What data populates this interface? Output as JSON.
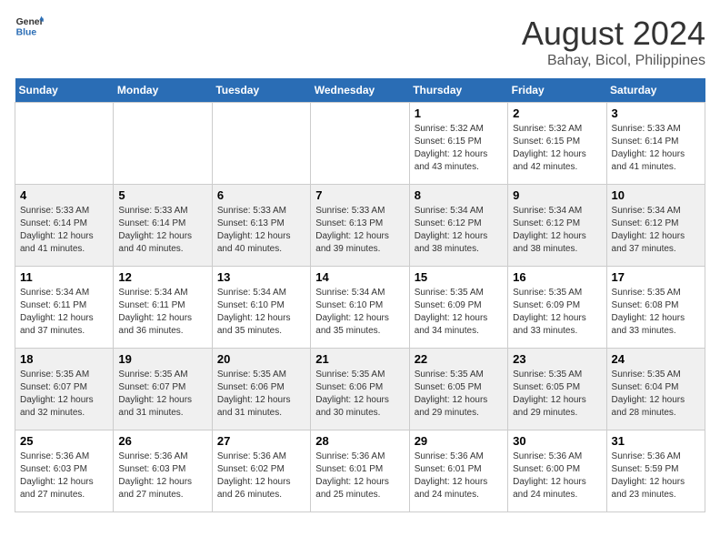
{
  "header": {
    "logo_line1": "General",
    "logo_line2": "Blue",
    "main_title": "August 2024",
    "subtitle": "Bahay, Bicol, Philippines"
  },
  "days_of_week": [
    "Sunday",
    "Monday",
    "Tuesday",
    "Wednesday",
    "Thursday",
    "Friday",
    "Saturday"
  ],
  "weeks": [
    {
      "days": [
        {
          "number": "",
          "info": ""
        },
        {
          "number": "",
          "info": ""
        },
        {
          "number": "",
          "info": ""
        },
        {
          "number": "",
          "info": ""
        },
        {
          "number": "1",
          "info": "Sunrise: 5:32 AM\nSunset: 6:15 PM\nDaylight: 12 hours and 43 minutes."
        },
        {
          "number": "2",
          "info": "Sunrise: 5:32 AM\nSunset: 6:15 PM\nDaylight: 12 hours and 42 minutes."
        },
        {
          "number": "3",
          "info": "Sunrise: 5:33 AM\nSunset: 6:14 PM\nDaylight: 12 hours and 41 minutes."
        }
      ]
    },
    {
      "days": [
        {
          "number": "4",
          "info": "Sunrise: 5:33 AM\nSunset: 6:14 PM\nDaylight: 12 hours and 41 minutes."
        },
        {
          "number": "5",
          "info": "Sunrise: 5:33 AM\nSunset: 6:14 PM\nDaylight: 12 hours and 40 minutes."
        },
        {
          "number": "6",
          "info": "Sunrise: 5:33 AM\nSunset: 6:13 PM\nDaylight: 12 hours and 40 minutes."
        },
        {
          "number": "7",
          "info": "Sunrise: 5:33 AM\nSunset: 6:13 PM\nDaylight: 12 hours and 39 minutes."
        },
        {
          "number": "8",
          "info": "Sunrise: 5:34 AM\nSunset: 6:12 PM\nDaylight: 12 hours and 38 minutes."
        },
        {
          "number": "9",
          "info": "Sunrise: 5:34 AM\nSunset: 6:12 PM\nDaylight: 12 hours and 38 minutes."
        },
        {
          "number": "10",
          "info": "Sunrise: 5:34 AM\nSunset: 6:12 PM\nDaylight: 12 hours and 37 minutes."
        }
      ]
    },
    {
      "days": [
        {
          "number": "11",
          "info": "Sunrise: 5:34 AM\nSunset: 6:11 PM\nDaylight: 12 hours and 37 minutes."
        },
        {
          "number": "12",
          "info": "Sunrise: 5:34 AM\nSunset: 6:11 PM\nDaylight: 12 hours and 36 minutes."
        },
        {
          "number": "13",
          "info": "Sunrise: 5:34 AM\nSunset: 6:10 PM\nDaylight: 12 hours and 35 minutes."
        },
        {
          "number": "14",
          "info": "Sunrise: 5:34 AM\nSunset: 6:10 PM\nDaylight: 12 hours and 35 minutes."
        },
        {
          "number": "15",
          "info": "Sunrise: 5:35 AM\nSunset: 6:09 PM\nDaylight: 12 hours and 34 minutes."
        },
        {
          "number": "16",
          "info": "Sunrise: 5:35 AM\nSunset: 6:09 PM\nDaylight: 12 hours and 33 minutes."
        },
        {
          "number": "17",
          "info": "Sunrise: 5:35 AM\nSunset: 6:08 PM\nDaylight: 12 hours and 33 minutes."
        }
      ]
    },
    {
      "days": [
        {
          "number": "18",
          "info": "Sunrise: 5:35 AM\nSunset: 6:07 PM\nDaylight: 12 hours and 32 minutes."
        },
        {
          "number": "19",
          "info": "Sunrise: 5:35 AM\nSunset: 6:07 PM\nDaylight: 12 hours and 31 minutes."
        },
        {
          "number": "20",
          "info": "Sunrise: 5:35 AM\nSunset: 6:06 PM\nDaylight: 12 hours and 31 minutes."
        },
        {
          "number": "21",
          "info": "Sunrise: 5:35 AM\nSunset: 6:06 PM\nDaylight: 12 hours and 30 minutes."
        },
        {
          "number": "22",
          "info": "Sunrise: 5:35 AM\nSunset: 6:05 PM\nDaylight: 12 hours and 29 minutes."
        },
        {
          "number": "23",
          "info": "Sunrise: 5:35 AM\nSunset: 6:05 PM\nDaylight: 12 hours and 29 minutes."
        },
        {
          "number": "24",
          "info": "Sunrise: 5:35 AM\nSunset: 6:04 PM\nDaylight: 12 hours and 28 minutes."
        }
      ]
    },
    {
      "days": [
        {
          "number": "25",
          "info": "Sunrise: 5:36 AM\nSunset: 6:03 PM\nDaylight: 12 hours and 27 minutes."
        },
        {
          "number": "26",
          "info": "Sunrise: 5:36 AM\nSunset: 6:03 PM\nDaylight: 12 hours and 27 minutes."
        },
        {
          "number": "27",
          "info": "Sunrise: 5:36 AM\nSunset: 6:02 PM\nDaylight: 12 hours and 26 minutes."
        },
        {
          "number": "28",
          "info": "Sunrise: 5:36 AM\nSunset: 6:01 PM\nDaylight: 12 hours and 25 minutes."
        },
        {
          "number": "29",
          "info": "Sunrise: 5:36 AM\nSunset: 6:01 PM\nDaylight: 12 hours and 24 minutes."
        },
        {
          "number": "30",
          "info": "Sunrise: 5:36 AM\nSunset: 6:00 PM\nDaylight: 12 hours and 24 minutes."
        },
        {
          "number": "31",
          "info": "Sunrise: 5:36 AM\nSunset: 5:59 PM\nDaylight: 12 hours and 23 minutes."
        }
      ]
    }
  ]
}
